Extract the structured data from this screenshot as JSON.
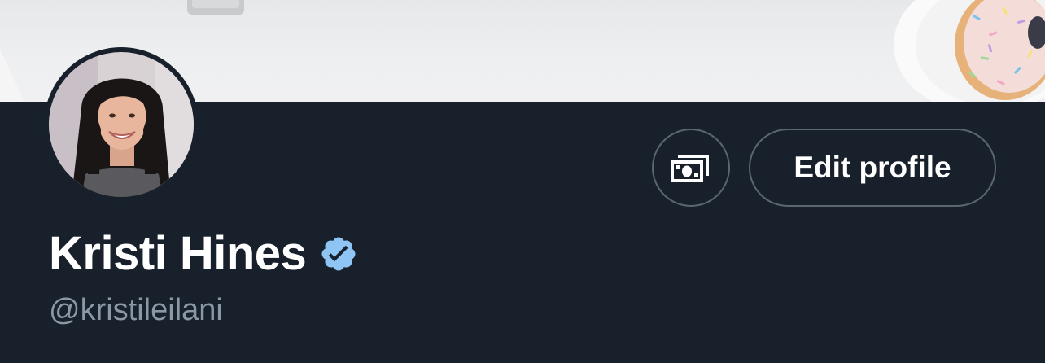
{
  "profile": {
    "display_name": "Kristi Hines",
    "handle": "@kristileilani",
    "verified": true,
    "edit_button_label": "Edit profile"
  },
  "icons": {
    "tip": "money-bill-icon",
    "verified": "verified-badge-icon"
  },
  "colors": {
    "background": "#17202b",
    "button_border": "#5b6670",
    "verified_blue": "#8ec5f5",
    "handle_text": "#8b98a5"
  }
}
